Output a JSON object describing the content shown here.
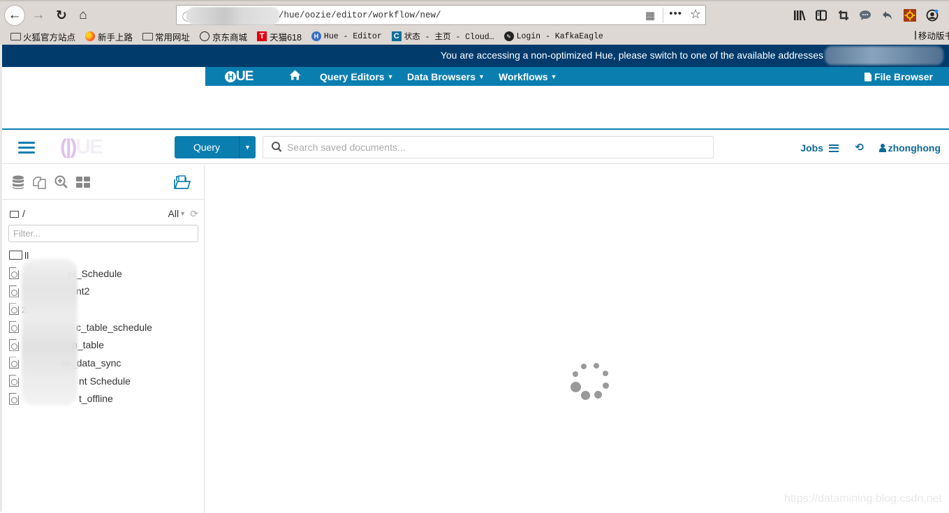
{
  "browser": {
    "url": "/hue/oozie/editor/workflow/new/",
    "bookmarks": [
      {
        "icon": "folder-icon",
        "label": "火狐官方站点"
      },
      {
        "icon": "firefox-icon",
        "label": "新手上路"
      },
      {
        "icon": "folder-icon",
        "label": "常用网址"
      },
      {
        "icon": "globe-icon",
        "label": "京东商城"
      },
      {
        "icon": "tmall-icon",
        "label": "天猫618"
      },
      {
        "icon": "hue-icon",
        "label": "Hue - Editor"
      },
      {
        "icon": "c-icon",
        "label": "状态 - 主页 - Cloud…"
      },
      {
        "icon": "kafkaeagle-icon",
        "label": "Login - KafkaEagle"
      }
    ],
    "mobile_bookmarks": "移动版书签",
    "toolbar_icons": [
      "library-icon",
      "sidebar-icon",
      "crop-icon",
      "chat-icon",
      "undo-icon",
      "extension-icon",
      "account-icon"
    ]
  },
  "banner": {
    "text": "You are accessing a non-optimized Hue, please switch to one of the available addresses"
  },
  "topnav": {
    "logo": "HUE",
    "items": [
      {
        "label": "Query Editors",
        "caret": "▼"
      },
      {
        "label": "Data Browsers",
        "caret": "▼"
      },
      {
        "label": "Workflows",
        "caret": "▼"
      }
    ],
    "file_browser": "File Browser"
  },
  "header": {
    "query_button": "Query",
    "search_placeholder": "Search saved documents...",
    "jobs": "Jobs",
    "user": "zhonghong"
  },
  "sidebar": {
    "path": "/",
    "filter_all": "All",
    "filter_placeholder": "Filter...",
    "items": [
      {
        "type": "folder",
        "name": "ll"
      },
      {
        "type": "document",
        "name": "ht_Schedule"
      },
      {
        "type": "document",
        "name": "nt2"
      },
      {
        "type": "document",
        "name": "z"
      },
      {
        "type": "document",
        "name": "c_table_schedule"
      },
      {
        "type": "document",
        "name": "p_table"
      },
      {
        "type": "document",
        "name": "se_data_sync"
      },
      {
        "type": "document",
        "name": "nt Schedule"
      },
      {
        "type": "document",
        "name": "t_offline"
      }
    ]
  },
  "main": {
    "status": "loading"
  },
  "watermark": "https://datamining.blog.csdn.net"
}
